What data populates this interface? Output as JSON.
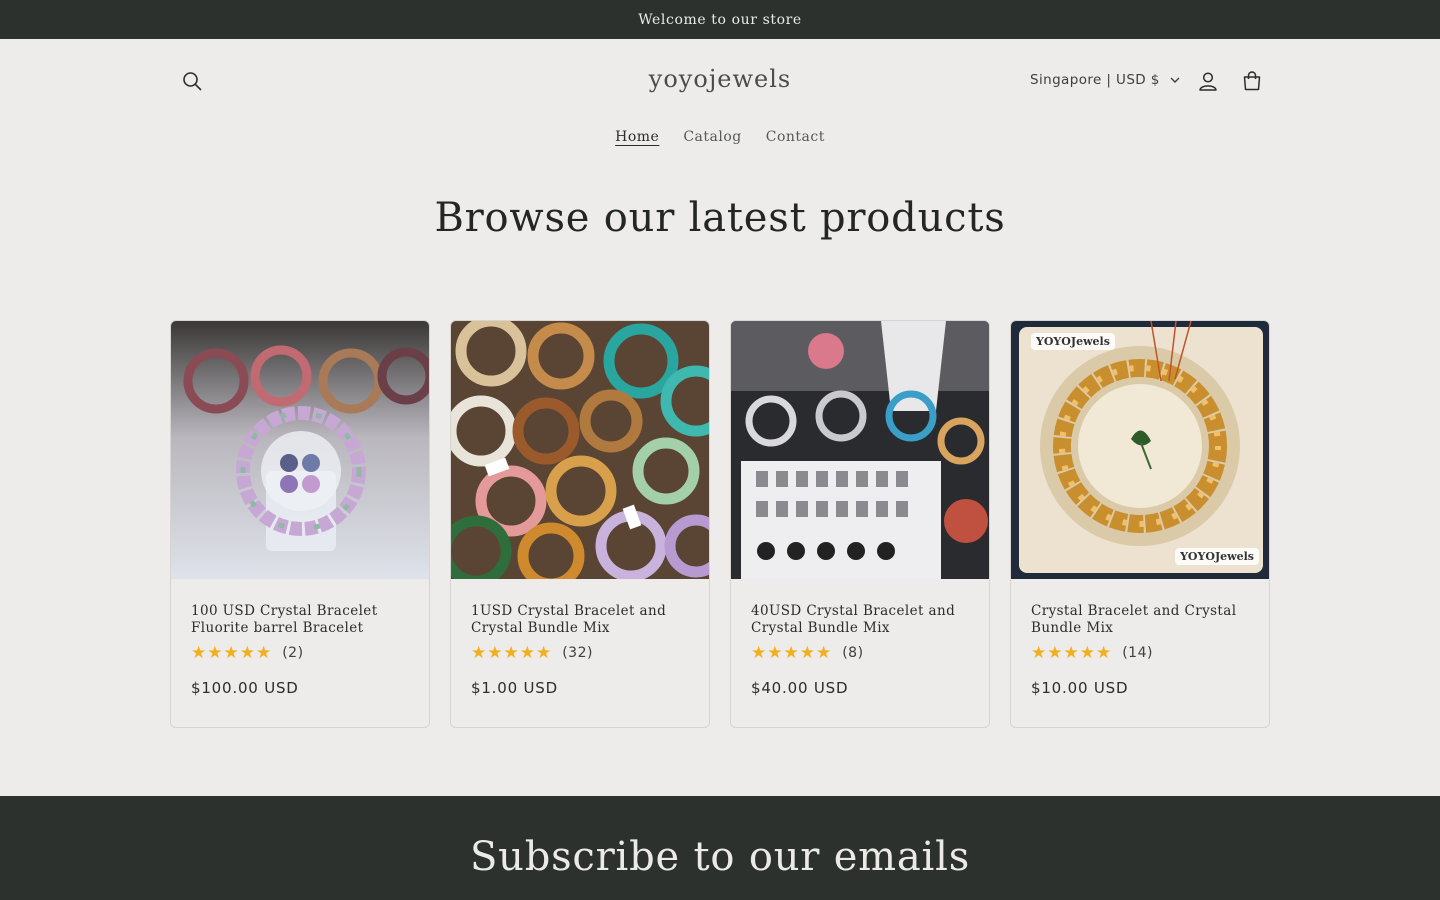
{
  "announcement": "Welcome to our store",
  "store": {
    "name": "yoyojewels"
  },
  "header": {
    "country_selector": "Singapore | USD $"
  },
  "nav": [
    {
      "label": "Home",
      "active": true
    },
    {
      "label": "Catalog",
      "active": false
    },
    {
      "label": "Contact",
      "active": false
    }
  ],
  "section": {
    "title": "Browse our latest products"
  },
  "products": [
    {
      "title": "100 USD Crystal Bracelet Fluorite barrel Bracelet",
      "rating": 5,
      "review_count": "(2)",
      "price": "$100.00 USD"
    },
    {
      "title": "1USD Crystal Bracelet and Crystal Bundle Mix",
      "rating": 5,
      "review_count": "(32)",
      "price": "$1.00 USD"
    },
    {
      "title": "40USD Crystal Bracelet and Crystal Bundle Mix",
      "rating": 5,
      "review_count": "(8)",
      "price": "$40.00 USD"
    },
    {
      "title": "Crystal Bracelet and Crystal Bundle Mix",
      "rating": 5,
      "review_count": "(14)",
      "price": "$10.00 USD",
      "image_badges": [
        "YOYOJewels",
        "YOYOJewels"
      ]
    }
  ],
  "newsletter": {
    "title": "Subscribe to our emails"
  },
  "icons": {
    "search": "search-icon",
    "account": "account-icon",
    "cart": "cart-icon",
    "chevron": "chevron-down-icon",
    "star": "star-icon"
  },
  "colors": {
    "dark_band": "#2c312e",
    "background": "#edeceb",
    "star": "#f2b01e"
  }
}
